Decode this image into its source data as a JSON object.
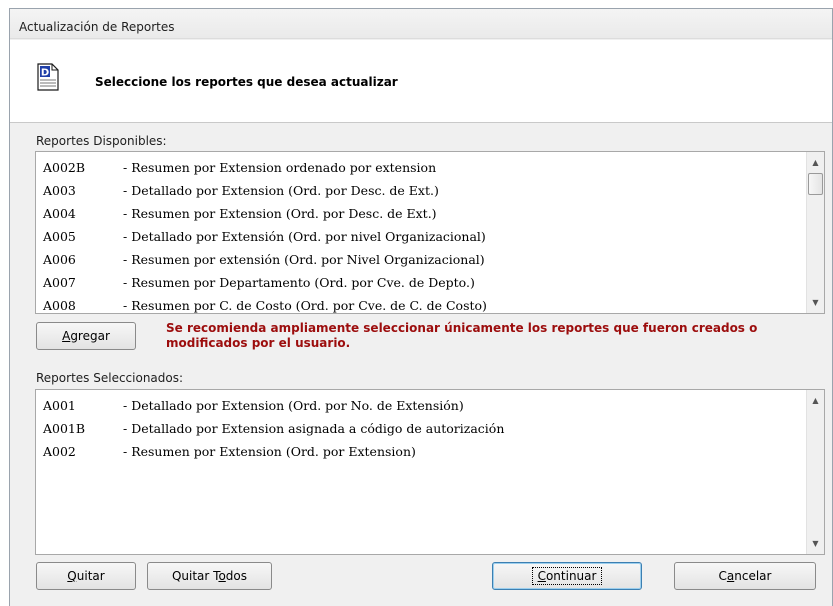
{
  "window": {
    "title": "Actualización de Reportes"
  },
  "header": {
    "icon": "document-d-icon",
    "heading": "Seleccione los reportes que desea actualizar"
  },
  "available": {
    "label": "Reportes Disponibles:",
    "items": [
      {
        "code": "A002B",
        "desc": "- Resumen por Extension ordenado por extension"
      },
      {
        "code": "A003",
        "desc": "- Detallado por Extension (Ord. por Desc. de Ext.)"
      },
      {
        "code": "A004",
        "desc": "- Resumen por Extension (Ord. por Desc. de Ext.)"
      },
      {
        "code": "A005",
        "desc": "- Detallado por Extensión (Ord. por nivel Organizacional)"
      },
      {
        "code": "A006",
        "desc": "- Resumen  por extensión (Ord. por Nivel Organizacional)"
      },
      {
        "code": "A007",
        "desc": "- Resumen por Departamento (Ord. por Cve. de Depto.)"
      },
      {
        "code": "A008",
        "desc": "- Resumen por C. de Costo (Ord. por Cve. de C. de Costo)"
      }
    ]
  },
  "add_button": {
    "label_pre": "",
    "label_ul": "A",
    "label_post": "gregar"
  },
  "warning": "Se recomienda ampliamente seleccionar únicamente los reportes que fueron creados o modificados por el usuario.",
  "selected": {
    "label": "Reportes Seleccionados:",
    "items": [
      {
        "code": "A001",
        "desc": "- Detallado por Extension (Ord. por No. de Extensión)"
      },
      {
        "code": "A001B",
        "desc": "- Detallado por Extension asignada a código de autorización"
      },
      {
        "code": "A002",
        "desc": "- Resumen por Extension (Ord. por Extension)"
      }
    ]
  },
  "buttons": {
    "quitar": {
      "ul": "Q",
      "rest": "uitar"
    },
    "quitar_todos": {
      "pre": "Quitar T",
      "ul": "o",
      "post": "dos"
    },
    "continuar": {
      "ul": "C",
      "rest": "ontinuar"
    },
    "cancelar": {
      "pre": "C",
      "ul": "a",
      "post": "ncelar"
    }
  }
}
